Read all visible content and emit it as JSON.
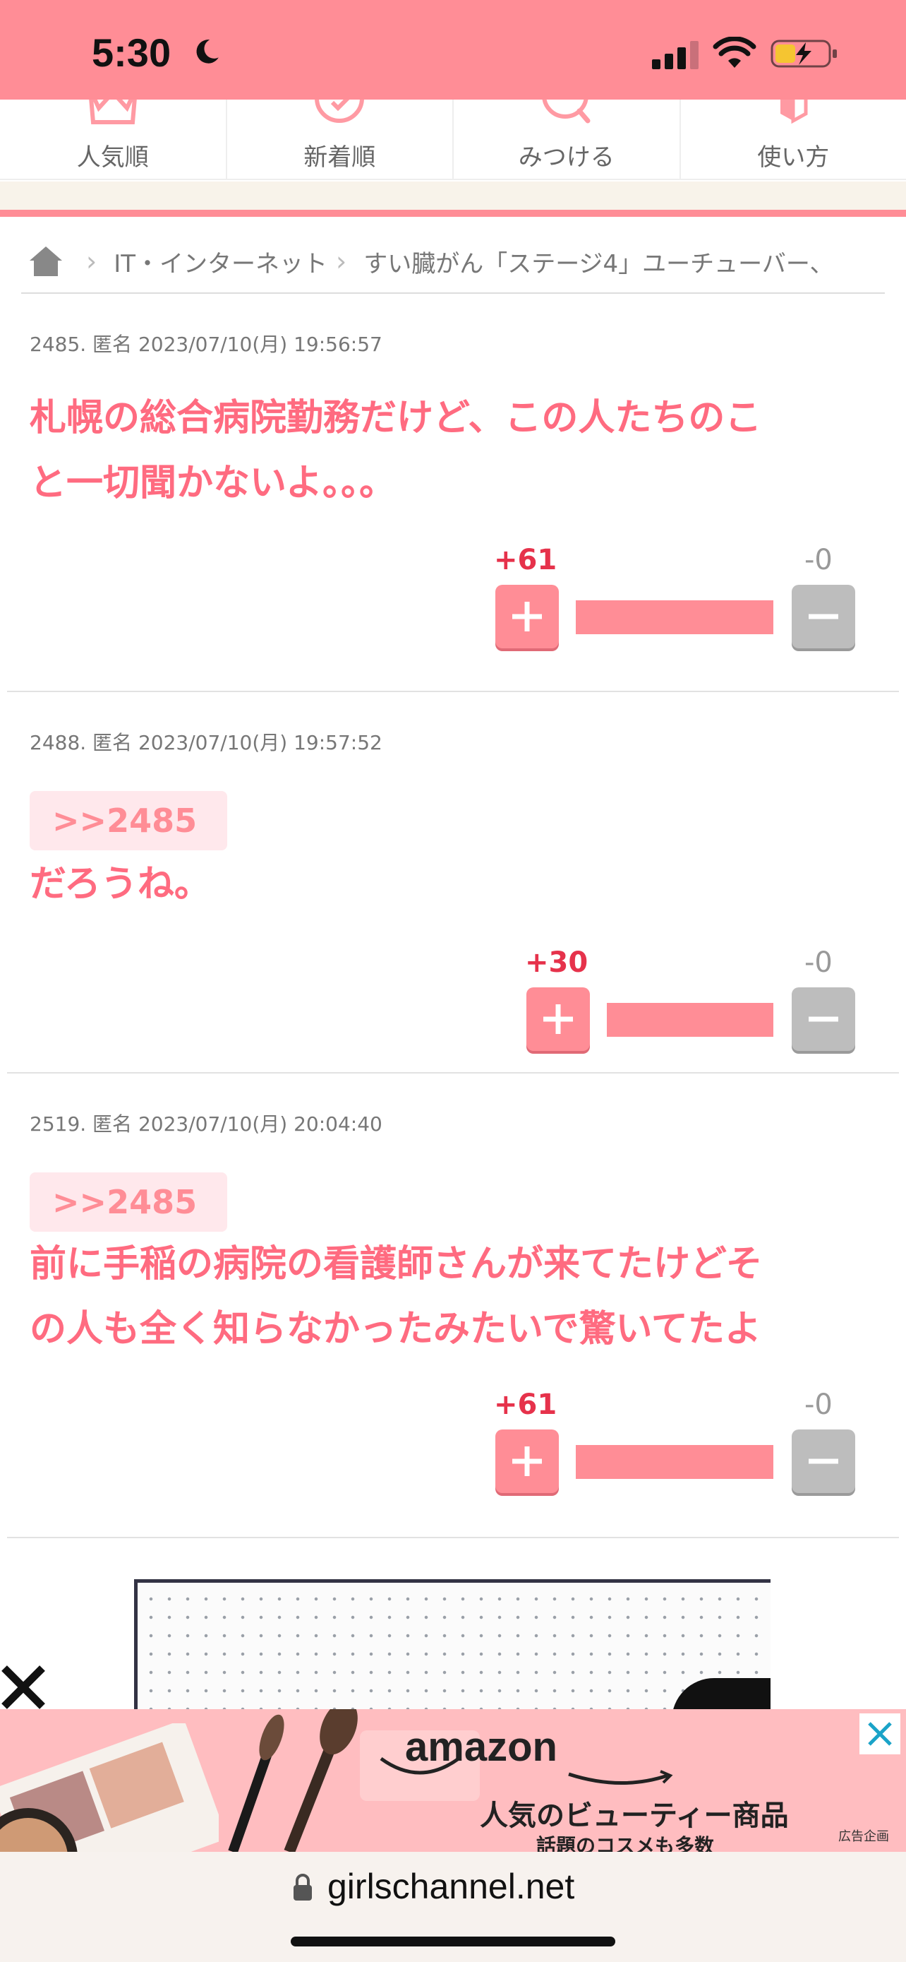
{
  "status_bar": {
    "time": "5:30"
  },
  "nav_tabs": [
    {
      "label": "人気順",
      "icon": "crown-icon"
    },
    {
      "label": "新着順",
      "icon": "clock-icon"
    },
    {
      "label": "みつける",
      "icon": "search-icon"
    },
    {
      "label": "使い方",
      "icon": "book-icon"
    }
  ],
  "breadcrumb": {
    "category": "IT・インターネット",
    "topic": "すい臓がん「ステージ4」ユーチューバー、"
  },
  "comments": [
    {
      "meta": "2485. 匿名 2023/07/10(月) 19:56:57",
      "anchor": "",
      "lines": [
        "札幌の総合病院勤務だけど、この人たちのこ",
        "と一切聞かないよ。。。"
      ],
      "plus": "+61",
      "minus": "-0",
      "plus_ratio": 1.0
    },
    {
      "meta": "2488. 匿名 2023/07/10(月) 19:57:52",
      "anchor": ">>2485",
      "lines": [
        "だろうね。"
      ],
      "plus": "+30",
      "minus": "-0",
      "plus_ratio": 1.0
    },
    {
      "meta": "2519. 匿名 2023/07/10(月) 20:04:40",
      "anchor": ">>2485",
      "lines": [
        "前に手稲の病院の看護師さんが来てたけどそ",
        "の人も全く知らなかったみたいで驚いてたよ"
      ],
      "plus": "+61",
      "minus": "-0",
      "plus_ratio": 1.0
    }
  ],
  "banner_ad": {
    "brand": "amazon",
    "headline": "人気のビューティー商品",
    "subline": "話題のコスメも多数",
    "tag": "広告企画"
  },
  "url_bar": {
    "url": "girlschannel.net"
  },
  "colors": {
    "accent": "#ff8d96",
    "text_pink": "#ff6b80",
    "plus_red": "#e6324b"
  }
}
